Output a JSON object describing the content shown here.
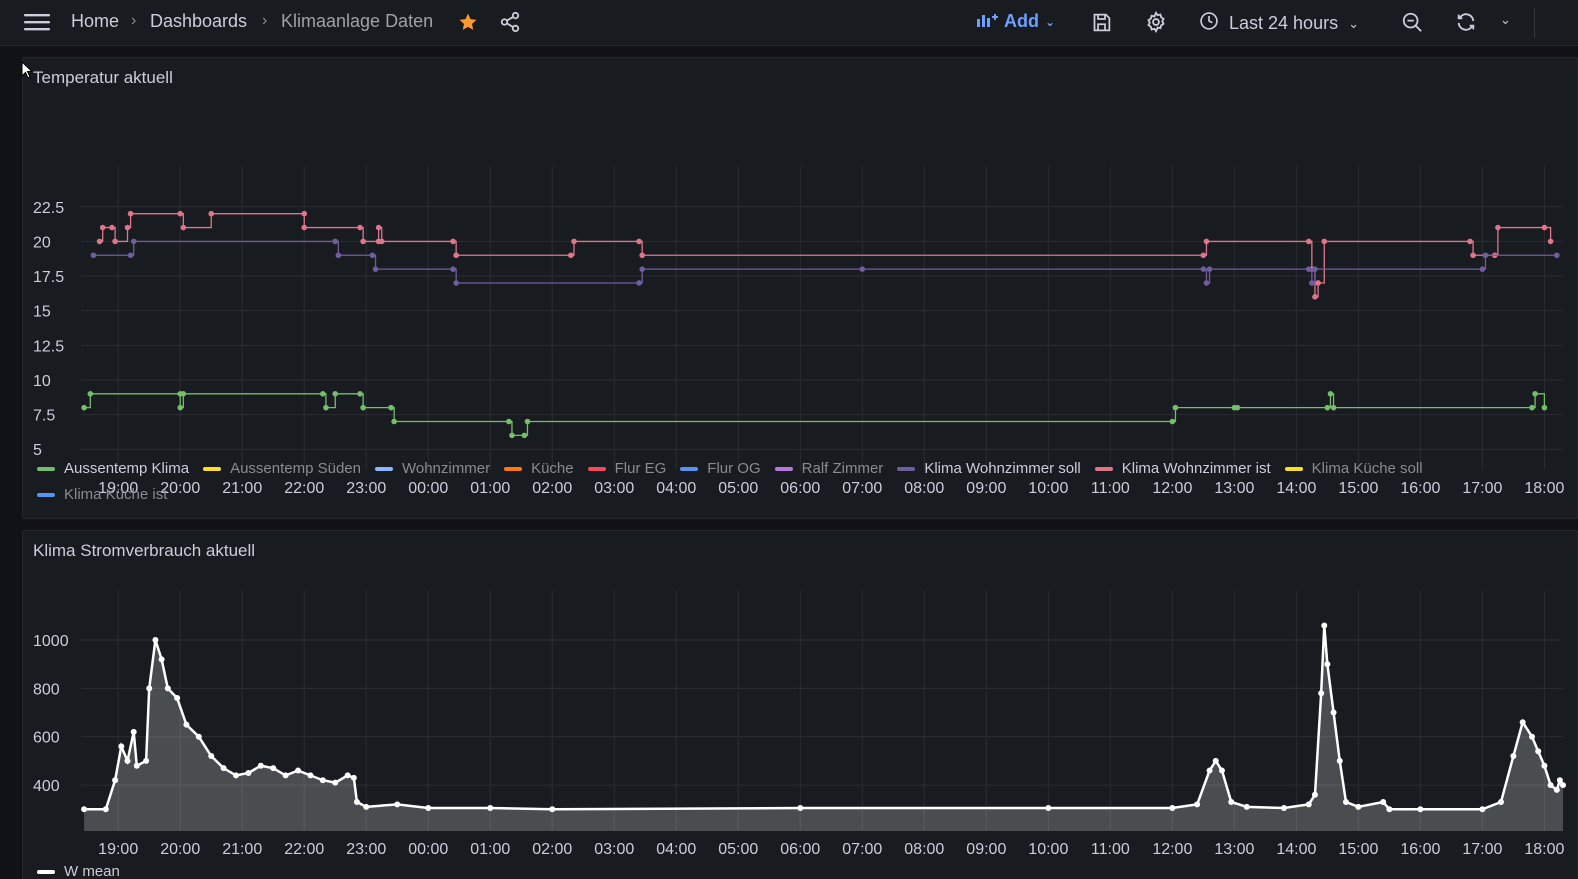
{
  "header": {
    "breadcrumbs": [
      "Home",
      "Dashboards",
      "Klimaanlage Daten"
    ],
    "add_label": "Add",
    "time_range": "Last 24 hours",
    "icons": [
      "menu-icon",
      "star-icon",
      "share-icon",
      "chart-add-icon",
      "save-icon",
      "gear-icon",
      "clock-icon",
      "zoom-out-icon",
      "refresh-icon",
      "chevron-down-icon"
    ],
    "colors": {
      "accent": "#6e9fff",
      "star": "#ff9830"
    }
  },
  "panels": [
    {
      "title": "Temperatur aktuell",
      "legend": [
        {
          "label": "Aussentemp Klima",
          "color": "#73bf69",
          "active": true
        },
        {
          "label": "Aussentemp Süden",
          "color": "#fade2a",
          "active": false
        },
        {
          "label": "Wohnzimmer",
          "color": "#8ab8ff",
          "active": false
        },
        {
          "label": "Küche",
          "color": "#ff780a",
          "active": false
        },
        {
          "label": "Flur EG",
          "color": "#f2495c",
          "active": false
        },
        {
          "label": "Flur OG",
          "color": "#5794f2",
          "active": false
        },
        {
          "label": "Ralf Zimmer",
          "color": "#b877d9",
          "active": false
        },
        {
          "label": "Klima Wohnzimmer soll",
          "color": "#705da0",
          "active": true
        },
        {
          "label": "Klima Wohnzimmer ist",
          "color": "#e0758a",
          "active": true
        },
        {
          "label": "Klima Küche soll",
          "color": "#fade2a",
          "active": false
        },
        {
          "label": "Klima Küche ist",
          "color": "#5794f2",
          "active": false
        }
      ]
    },
    {
      "title": "Klima Stromverbrauch aktuell",
      "legend": [
        {
          "label": "W mean",
          "color": "#ffffff",
          "active": true
        }
      ]
    }
  ],
  "chart_data": [
    {
      "type": "line",
      "title": "Temperatur aktuell",
      "x_ticks": [
        "19:00",
        "20:00",
        "21:00",
        "22:00",
        "23:00",
        "00:00",
        "01:00",
        "02:00",
        "03:00",
        "04:00",
        "05:00",
        "06:00",
        "07:00",
        "08:00",
        "09:00",
        "10:00",
        "11:00",
        "12:00",
        "13:00",
        "14:00",
        "15:00",
        "16:00",
        "17:00",
        "18:00"
      ],
      "y_ticks": [
        "5",
        "7.5",
        "10",
        "12.5",
        "15",
        "17.5",
        "20",
        "22.5"
      ],
      "ylim": [
        3.5,
        24
      ],
      "xlim": [
        18.4,
        42.3
      ],
      "grid": true,
      "legend_position": "bottom-left",
      "series": [
        {
          "name": "Klima Wohnzimmer ist",
          "color": "#e0758a",
          "points": [
            [
              18.7,
              20
            ],
            [
              18.75,
              21
            ],
            [
              18.9,
              21
            ],
            [
              18.95,
              20
            ],
            [
              19.15,
              21
            ],
            [
              19.2,
              22
            ],
            [
              20.0,
              22
            ],
            [
              20.05,
              21
            ],
            [
              20.5,
              22
            ],
            [
              22.0,
              22
            ],
            [
              22.0,
              21
            ],
            [
              22.9,
              21
            ],
            [
              22.95,
              20
            ],
            [
              23.2,
              20
            ],
            [
              23.2,
              21
            ],
            [
              23.25,
              20
            ],
            [
              24.4,
              20
            ],
            [
              24.45,
              19
            ],
            [
              26.3,
              19
            ],
            [
              26.35,
              20
            ],
            [
              27.4,
              20
            ],
            [
              27.45,
              19
            ],
            [
              36.5,
              19
            ],
            [
              36.55,
              20
            ],
            [
              38.2,
              20
            ],
            [
              38.25,
              18
            ],
            [
              38.3,
              16
            ],
            [
              38.35,
              17
            ],
            [
              38.45,
              20
            ],
            [
              40.8,
              20
            ],
            [
              40.85,
              19
            ],
            [
              41.2,
              19
            ],
            [
              41.25,
              21
            ],
            [
              42.0,
              21
            ],
            [
              42.1,
              20
            ]
          ]
        },
        {
          "name": "Klima Wohnzimmer soll",
          "color": "#705da0",
          "points": [
            [
              18.6,
              19
            ],
            [
              19.2,
              19
            ],
            [
              19.25,
              20
            ],
            [
              22.5,
              20
            ],
            [
              22.55,
              19
            ],
            [
              23.1,
              19
            ],
            [
              23.15,
              18
            ],
            [
              24.4,
              18
            ],
            [
              24.45,
              17
            ],
            [
              27.4,
              17
            ],
            [
              27.45,
              18
            ],
            [
              31.0,
              18
            ],
            [
              36.5,
              18
            ],
            [
              36.55,
              17
            ],
            [
              36.6,
              18
            ],
            [
              38.2,
              18
            ],
            [
              38.25,
              17
            ],
            [
              38.3,
              18
            ],
            [
              41.0,
              18
            ],
            [
              41.05,
              19
            ],
            [
              42.2,
              19
            ]
          ]
        },
        {
          "name": "Aussentemp Klima",
          "color": "#73bf69",
          "points": [
            [
              18.45,
              8
            ],
            [
              18.55,
              9
            ],
            [
              20.0,
              9
            ],
            [
              20.0,
              8
            ],
            [
              20.05,
              9
            ],
            [
              22.3,
              9
            ],
            [
              22.35,
              8
            ],
            [
              22.5,
              9
            ],
            [
              22.9,
              9
            ],
            [
              22.95,
              8
            ],
            [
              23.4,
              8
            ],
            [
              23.45,
              7
            ],
            [
              25.3,
              7
            ],
            [
              25.35,
              6
            ],
            [
              25.55,
              6
            ],
            [
              25.6,
              7
            ],
            [
              36.0,
              7
            ],
            [
              36.05,
              8
            ],
            [
              37.0,
              8
            ],
            [
              37.05,
              8
            ],
            [
              38.5,
              8
            ],
            [
              38.55,
              9
            ],
            [
              38.6,
              8
            ],
            [
              41.8,
              8
            ],
            [
              41.85,
              9
            ],
            [
              42.0,
              8
            ]
          ]
        }
      ]
    },
    {
      "type": "area",
      "title": "Klima Stromverbrauch aktuell",
      "x_ticks": [
        "19:00",
        "20:00",
        "21:00",
        "22:00",
        "23:00",
        "00:00",
        "01:00",
        "02:00",
        "03:00",
        "04:00",
        "05:00",
        "06:00",
        "07:00",
        "08:00",
        "09:00",
        "10:00",
        "11:00",
        "12:00",
        "13:00",
        "14:00",
        "15:00",
        "16:00",
        "17:00",
        "18:00"
      ],
      "y_ticks": [
        "400",
        "600",
        "800",
        "1000"
      ],
      "ylim": [
        210,
        1120
      ],
      "xlim": [
        18.4,
        42.3
      ],
      "grid": true,
      "series": [
        {
          "name": "W mean",
          "color": "#ffffff",
          "points": [
            [
              18.45,
              300
            ],
            [
              18.8,
              300
            ],
            [
              18.95,
              420
            ],
            [
              19.05,
              560
            ],
            [
              19.15,
              500
            ],
            [
              19.25,
              620
            ],
            [
              19.3,
              480
            ],
            [
              19.45,
              500
            ],
            [
              19.5,
              800
            ],
            [
              19.6,
              1000
            ],
            [
              19.7,
              920
            ],
            [
              19.8,
              800
            ],
            [
              19.95,
              760
            ],
            [
              20.1,
              650
            ],
            [
              20.3,
              600
            ],
            [
              20.5,
              520
            ],
            [
              20.7,
              470
            ],
            [
              20.9,
              440
            ],
            [
              21.1,
              450
            ],
            [
              21.3,
              480
            ],
            [
              21.5,
              470
            ],
            [
              21.7,
              440
            ],
            [
              21.9,
              460
            ],
            [
              22.1,
              440
            ],
            [
              22.3,
              420
            ],
            [
              22.5,
              410
            ],
            [
              22.7,
              440
            ],
            [
              22.8,
              430
            ],
            [
              22.85,
              330
            ],
            [
              23.0,
              310
            ],
            [
              23.5,
              320
            ],
            [
              24.0,
              305
            ],
            [
              25.0,
              305
            ],
            [
              26.0,
              300
            ],
            [
              30.0,
              305
            ],
            [
              34.0,
              305
            ],
            [
              36.0,
              305
            ],
            [
              36.4,
              320
            ],
            [
              36.6,
              460
            ],
            [
              36.7,
              500
            ],
            [
              36.8,
              460
            ],
            [
              36.95,
              330
            ],
            [
              37.2,
              310
            ],
            [
              37.8,
              305
            ],
            [
              38.2,
              320
            ],
            [
              38.3,
              360
            ],
            [
              38.4,
              780
            ],
            [
              38.45,
              1060
            ],
            [
              38.5,
              900
            ],
            [
              38.6,
              700
            ],
            [
              38.7,
              500
            ],
            [
              38.8,
              330
            ],
            [
              39.0,
              310
            ],
            [
              39.4,
              330
            ],
            [
              39.5,
              300
            ],
            [
              40.0,
              300
            ],
            [
              41.0,
              300
            ],
            [
              41.3,
              330
            ],
            [
              41.5,
              520
            ],
            [
              41.65,
              660
            ],
            [
              41.8,
              600
            ],
            [
              41.9,
              540
            ],
            [
              42.0,
              480
            ],
            [
              42.1,
              400
            ],
            [
              42.2,
              380
            ],
            [
              42.25,
              420
            ],
            [
              42.3,
              400
            ]
          ]
        }
      ]
    }
  ]
}
